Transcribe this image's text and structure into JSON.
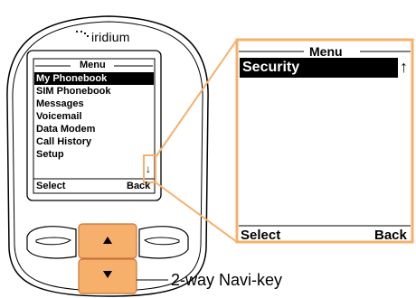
{
  "brand": "iridium",
  "phone_screen": {
    "menu_title": "Menu",
    "items": [
      "My Phonebook",
      "SIM Phonebook",
      "Messages",
      "Voicemail",
      "Data Modem",
      "Call History",
      "Setup"
    ],
    "selected_index": 0,
    "scroll_down_glyph": "↓",
    "softkey_left": "Select",
    "softkey_right": "Back"
  },
  "zoom_screen": {
    "menu_title": "Menu",
    "selected_item": "Security",
    "scroll_up_glyph": "↑",
    "softkey_left": "Select",
    "softkey_right": "Back"
  },
  "callout": {
    "label": "2-way Navi-key"
  },
  "icons": {
    "nav_up": "triangle-up-icon",
    "nav_down": "triangle-down-icon",
    "signal": "signal-dots-icon"
  },
  "colors": {
    "accent": "#f7b06b",
    "accent_dark": "#c8743a",
    "screen_bg": "#ffffff",
    "outline": "#000000",
    "body": "#ffffff"
  }
}
